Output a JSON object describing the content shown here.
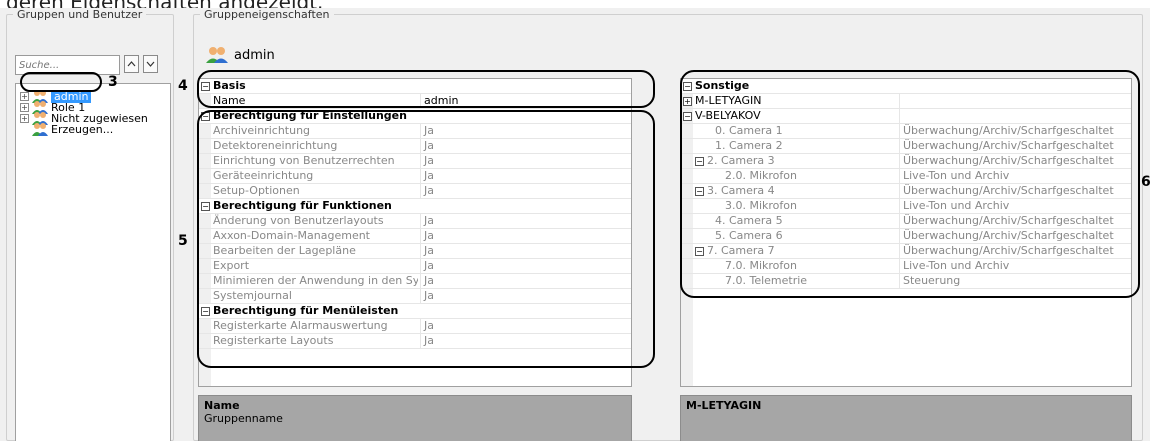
{
  "caption": "deren Eigenschaften angezeigt.",
  "left_group": {
    "legend": "Gruppen und Benutzer",
    "search_placeholder": "Suche...",
    "tree": [
      {
        "label": "admin",
        "selected": true
      },
      {
        "label": "Role 1"
      },
      {
        "label": "Nicht zugewiesen"
      },
      {
        "label": "Erzeugen..."
      }
    ]
  },
  "right_group": {
    "legend": "Gruppeneigenschaften",
    "title": "admin"
  },
  "left_props": {
    "rows": [
      {
        "type": "cat",
        "name": "Basis"
      },
      {
        "type": "prop",
        "name": "Name",
        "value": "admin",
        "dark": true
      },
      {
        "type": "cat",
        "name": "Berechtigung für Einstellungen"
      },
      {
        "type": "prop",
        "name": "Archiveinrichtung",
        "value": "Ja"
      },
      {
        "type": "prop",
        "name": "Detektoreneinrichtung",
        "value": "Ja"
      },
      {
        "type": "prop",
        "name": "Einrichtung von Benutzerrechten",
        "value": "Ja"
      },
      {
        "type": "prop",
        "name": "Geräteeinrichtung",
        "value": "Ja"
      },
      {
        "type": "prop",
        "name": "Setup-Optionen",
        "value": "Ja"
      },
      {
        "type": "cat",
        "name": "Berechtigung für Funktionen"
      },
      {
        "type": "prop",
        "name": "Änderung von Benutzerlayouts",
        "value": "Ja"
      },
      {
        "type": "prop",
        "name": "Axxon-Domain-Management",
        "value": "Ja"
      },
      {
        "type": "prop",
        "name": "Bearbeiten der Lagepläne",
        "value": "Ja"
      },
      {
        "type": "prop",
        "name": "Export",
        "value": "Ja"
      },
      {
        "type": "prop",
        "name": "Minimieren der Anwendung in den Sy",
        "value": "Ja"
      },
      {
        "type": "prop",
        "name": "Systemjournal",
        "value": "Ja"
      },
      {
        "type": "cat",
        "name": "Berechtigung für Menüleisten"
      },
      {
        "type": "prop",
        "name": "Registerkarte Alarmauswertung",
        "value": "Ja"
      },
      {
        "type": "prop",
        "name": "Registerkarte Layouts",
        "value": "Ja"
      }
    ],
    "desc_title": "Name",
    "desc_text": "Gruppenname"
  },
  "right_props": {
    "rows": [
      {
        "type": "cat",
        "name": "Sonstige",
        "sign": "⊟"
      },
      {
        "type": "prop",
        "name": "M-LETYAGIN",
        "value": "",
        "dark": true,
        "sign": "⊞",
        "indent": 0
      },
      {
        "type": "prop",
        "name": "V-BELYAKOV",
        "value": "",
        "dark": true,
        "sign": "⊟",
        "indent": 0
      },
      {
        "type": "prop",
        "name": "0. Camera 1",
        "value": "Überwachung/Archiv/Scharfgeschaltet",
        "indent": 2
      },
      {
        "type": "prop",
        "name": "1. Camera 2",
        "value": "Überwachung/Archiv/Scharfgeschaltet",
        "indent": 2
      },
      {
        "type": "prop",
        "name": "2. Camera 3",
        "value": "Überwachung/Archiv/Scharfgeschaltet",
        "sign": "⊟",
        "indent": 1
      },
      {
        "type": "prop",
        "name": "2.0. Mikrofon",
        "value": "Live-Ton und Archiv",
        "indent": 3
      },
      {
        "type": "prop",
        "name": "3. Camera 4",
        "value": "Überwachung/Archiv/Scharfgeschaltet",
        "sign": "⊟",
        "indent": 1
      },
      {
        "type": "prop",
        "name": "3.0. Mikrofon",
        "value": "Live-Ton und Archiv",
        "indent": 3
      },
      {
        "type": "prop",
        "name": "4. Camera 5",
        "value": "Überwachung/Archiv/Scharfgeschaltet",
        "indent": 2
      },
      {
        "type": "prop",
        "name": "5. Camera 6",
        "value": "Überwachung/Archiv/Scharfgeschaltet",
        "indent": 2
      },
      {
        "type": "prop",
        "name": "7. Camera 7",
        "value": "Überwachung/Archiv/Scharfgeschaltet",
        "sign": "⊟",
        "indent": 1
      },
      {
        "type": "prop",
        "name": "7.0. Mikrofon",
        "value": "Live-Ton und Archiv",
        "indent": 3
      },
      {
        "type": "prop",
        "name": "7.0. Telemetrie",
        "value": "Steuerung",
        "indent": 3
      }
    ],
    "desc_title": "M-LETYAGIN"
  },
  "callouts": [
    "3",
    "4",
    "5",
    "6"
  ]
}
